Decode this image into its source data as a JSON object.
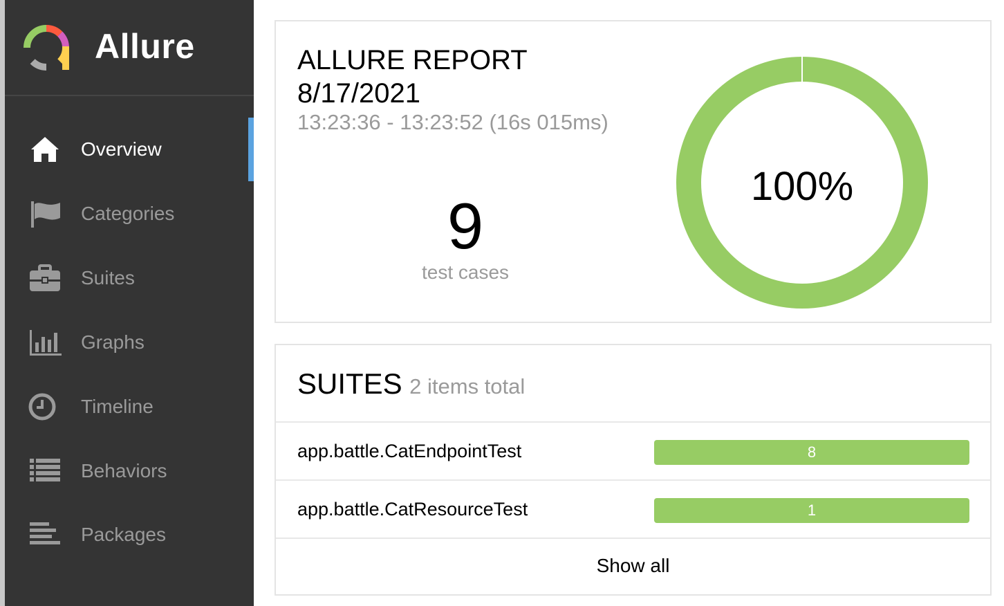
{
  "app": {
    "name": "Allure"
  },
  "sidebar": {
    "items": [
      {
        "label": "Overview",
        "icon": "home-icon",
        "active": true
      },
      {
        "label": "Categories",
        "icon": "flag-icon",
        "active": false
      },
      {
        "label": "Suites",
        "icon": "briefcase-icon",
        "active": false
      },
      {
        "label": "Graphs",
        "icon": "bar-chart-icon",
        "active": false
      },
      {
        "label": "Timeline",
        "icon": "clock-icon",
        "active": false
      },
      {
        "label": "Behaviors",
        "icon": "list-icon",
        "active": false
      },
      {
        "label": "Packages",
        "icon": "align-left-icon",
        "active": false
      }
    ]
  },
  "summary": {
    "title_line1": "ALLURE REPORT",
    "title_line2": "8/17/2021",
    "time_range": "13:23:36 - 13:23:52 (16s 015ms)",
    "test_count": "9",
    "test_count_label": "test cases",
    "success_rate": "100%"
  },
  "suites": {
    "title": "SUITES",
    "count_text": "2 items total",
    "rows": [
      {
        "name": "app.battle.CatEndpointTest",
        "passed": "8"
      },
      {
        "name": "app.battle.CatResourceTest",
        "passed": "1"
      }
    ],
    "show_all": "Show all"
  },
  "colors": {
    "passed": "#97cc64",
    "sidebar_bg": "#343434",
    "active_indicator": "#5ba3e0"
  }
}
